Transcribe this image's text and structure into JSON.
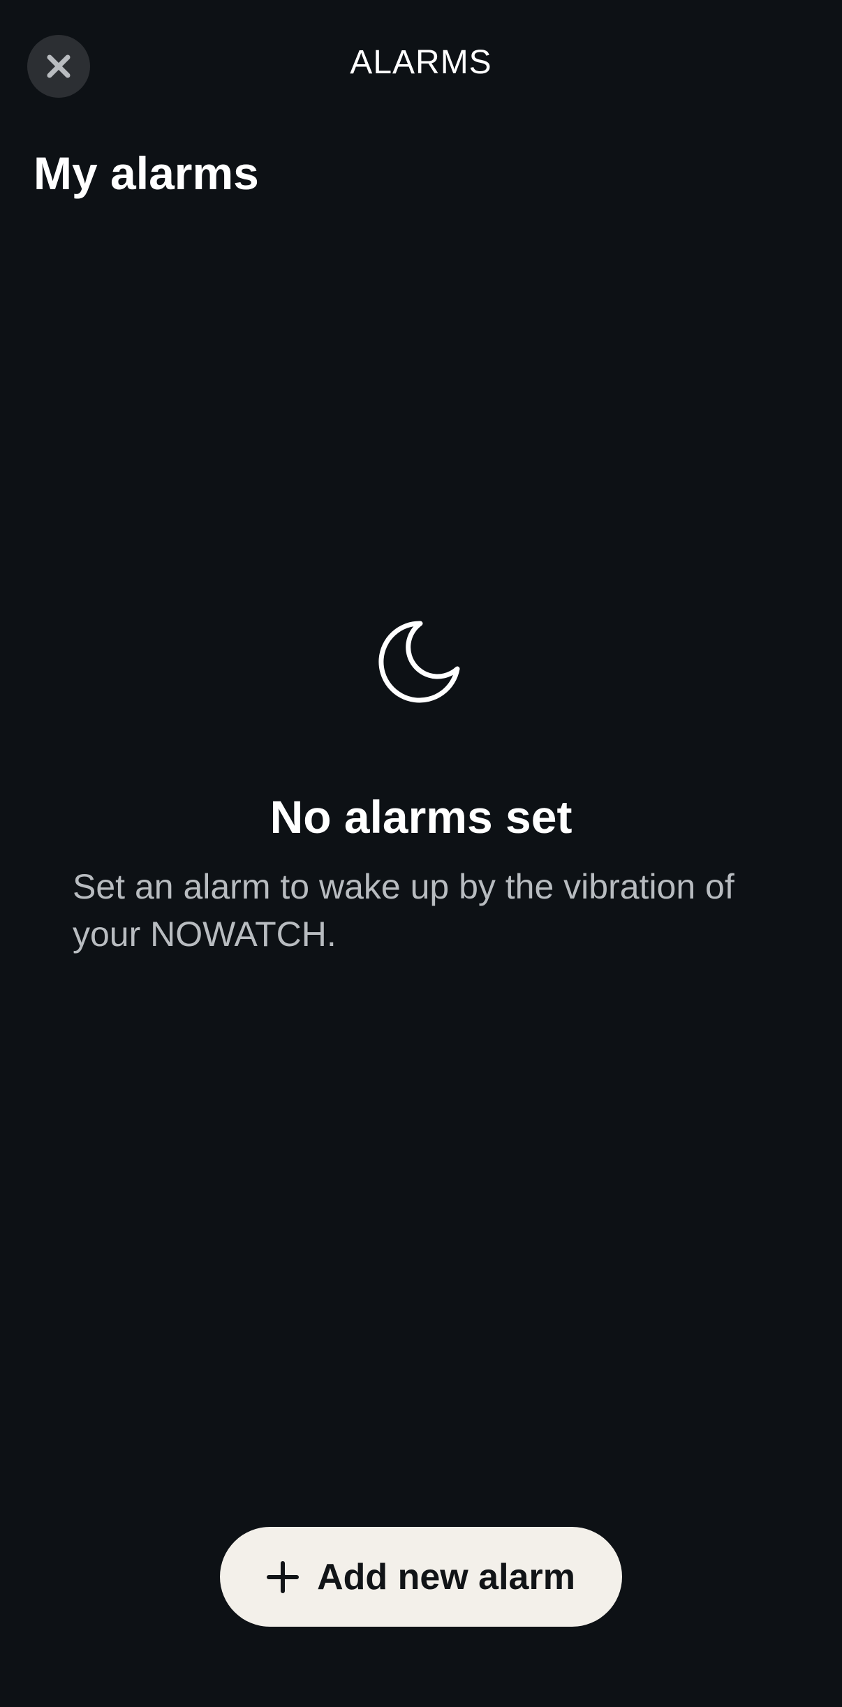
{
  "header": {
    "title": "ALARMS",
    "close_icon": "close-icon"
  },
  "page_title": "My alarms",
  "empty_state": {
    "icon": "moon-icon",
    "title": "No alarms set",
    "description": "Set an alarm to wake up by the vibration of your NOWATCH."
  },
  "add_button": {
    "icon": "plus-icon",
    "label": "Add new alarm"
  },
  "colors": {
    "background": "#0d1115",
    "close_button_bg": "#2c2f33",
    "primary_text": "#ffffff",
    "secondary_text": "#b8bcc0",
    "button_bg": "#f3f0ea",
    "button_text": "#111417"
  }
}
